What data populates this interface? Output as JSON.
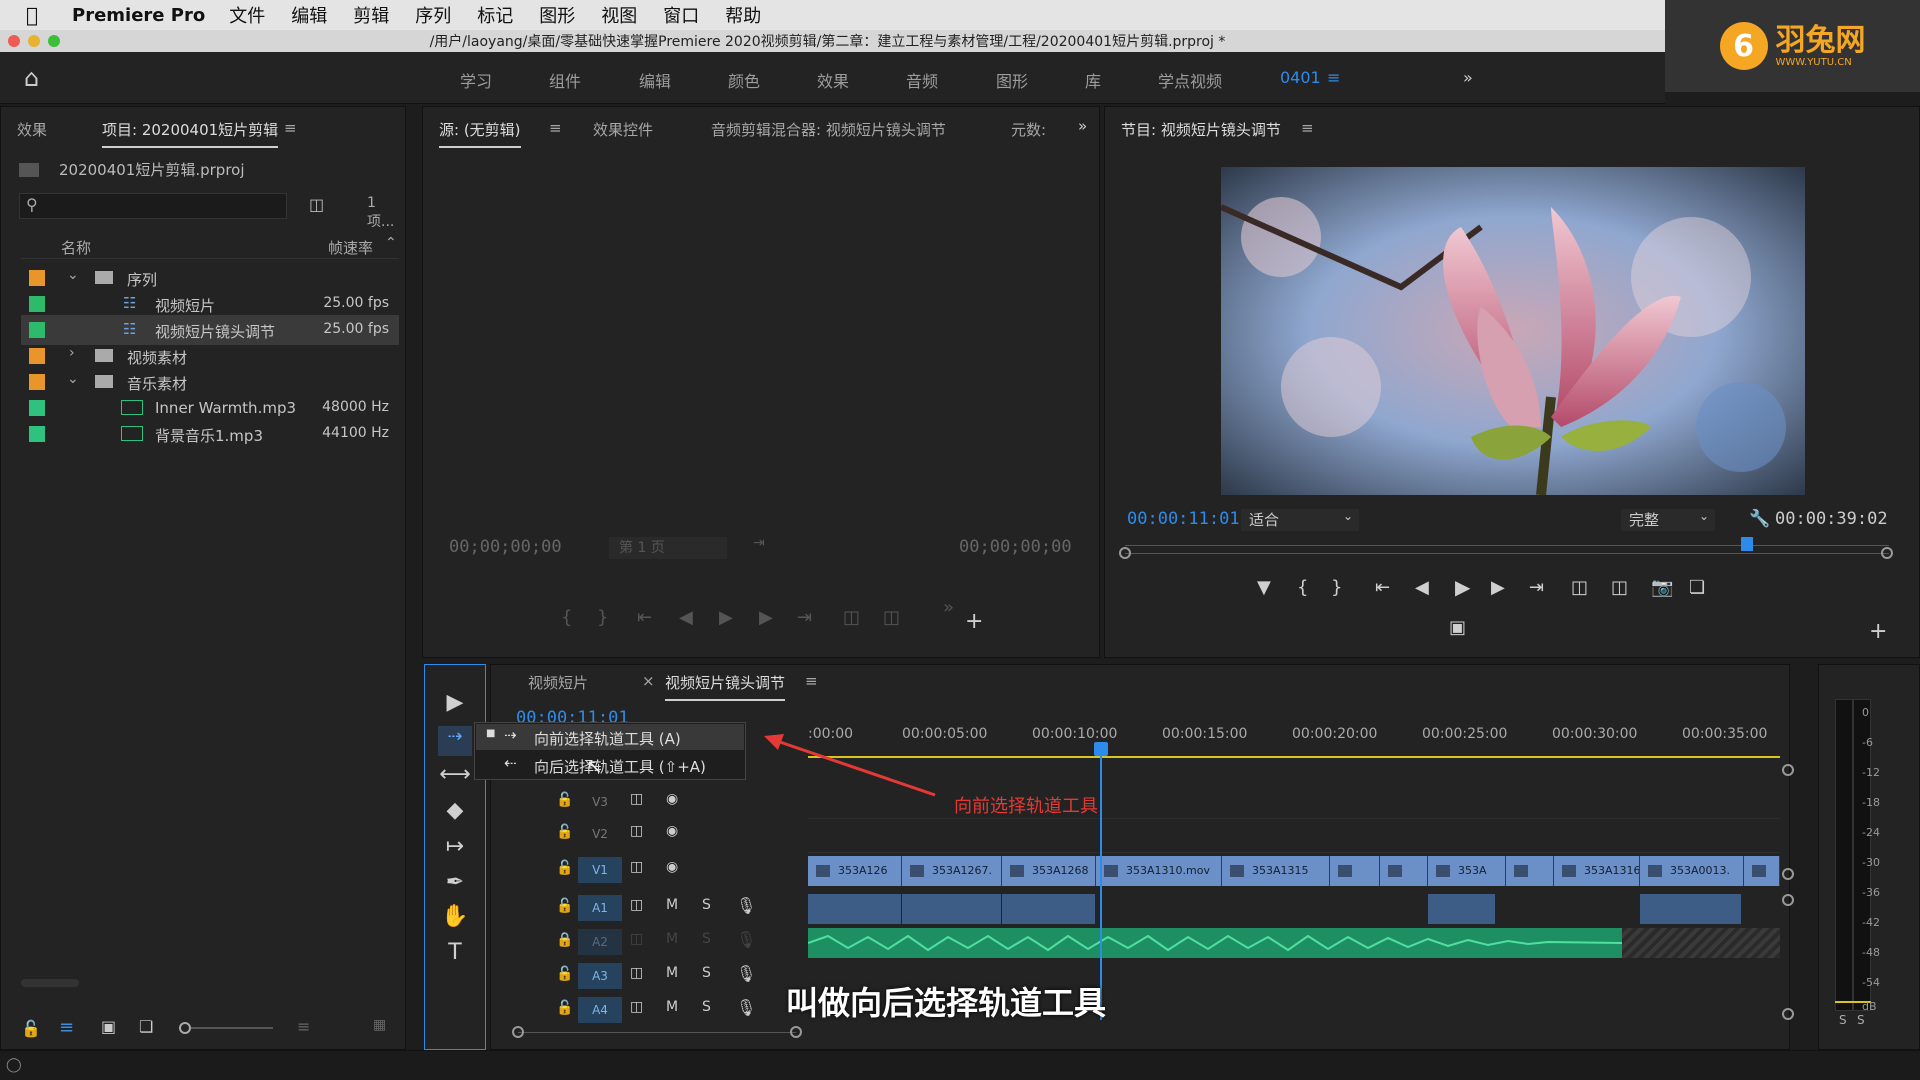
{
  "menubar": {
    "app_name": "Premiere Pro",
    "items": [
      "文件",
      "编辑",
      "剪辑",
      "序列",
      "标记",
      "图形",
      "视图",
      "窗口",
      "帮助"
    ]
  },
  "window_title": "/用户/laoyang/桌面/零基础快速掌握Premiere 2020视频剪辑/第二章：建立工程与素材管理/工程/20200401短片剪辑.prproj *",
  "logo": {
    "mark": "6",
    "name": "羽兔网",
    "url": "WWW.YUTU.CN"
  },
  "workspaces": [
    "学习",
    "组件",
    "编辑",
    "颜色",
    "效果",
    "音频",
    "图形",
    "库",
    "学点视频",
    "0401"
  ],
  "project": {
    "tab_effects": "效果",
    "tab_project": "项目: 20200401短片剪辑",
    "file_name": "20200401短片剪辑.prproj",
    "item_count": "1 项...",
    "col_name": "名称",
    "col_rate": "帧速率",
    "items": [
      {
        "name": "序列",
        "value": "",
        "color": "#e8962c"
      },
      {
        "name": "视频短片",
        "value": "25.00 fps",
        "color": "#2dbb6a"
      },
      {
        "name": "视频短片镜头调节",
        "value": "25.00 fps",
        "color": "#2dbb6a"
      },
      {
        "name": "视频素材",
        "value": "",
        "color": "#e8962c"
      },
      {
        "name": "音乐素材",
        "value": "",
        "color": "#e8962c"
      },
      {
        "name": "Inner Warmth.mp3",
        "value": "48000 Hz",
        "color": "#2ec27e"
      },
      {
        "name": "背景音乐1.mp3",
        "value": "44100 Hz",
        "color": "#2ec27e"
      }
    ]
  },
  "source": {
    "tab_source": "源: (无剪辑)",
    "tab_effect_controls": "效果控件",
    "tab_audio_mixer": "音频剪辑混合器: 视频短片镜头调节",
    "tab_meta": "元数:",
    "tc_left": "00;00;00;00",
    "tc_right": "00;00;00;00",
    "page": "第 1 页"
  },
  "program": {
    "tab": "节目: 视频短片镜头调节",
    "timecode": "00:00:11:01",
    "fit": "适合",
    "quality": "完整",
    "duration": "00:00:39:02"
  },
  "timeline": {
    "tab1": "视频短片",
    "tab2": "视频短片镜头调节",
    "timecode": "00:00:11:01",
    "ruler": [
      ":00:00",
      "00:00:05:00",
      "00:00:10:00",
      "00:00:15:00",
      "00:00:20:00",
      "00:00:25:00",
      "00:00:30:00",
      "00:00:35:00"
    ],
    "menu_forward": "向前选择轨道工具 (A)",
    "menu_backward": "向后选择轨道工具 (⇧+A)",
    "annotation": "向前选择轨道工具",
    "subtitle": "叫做向后选择轨道工具",
    "tracks": [
      "V3",
      "V2",
      "V1",
      "A1",
      "A2",
      "A3",
      "A4"
    ],
    "clips": [
      "353A126",
      "353A1267.",
      "353A1268",
      "353A1310.mov",
      "353A1315",
      "",
      "",
      "353A",
      "",
      "353A1316",
      "353A0013.",
      ""
    ],
    "mute": "M",
    "solo": "S"
  },
  "meter": {
    "labels": [
      "0",
      "-6",
      "-12",
      "-18",
      "-24",
      "-30",
      "-36",
      "-42",
      "-48",
      "-54",
      "dB"
    ],
    "solo": "S"
  }
}
